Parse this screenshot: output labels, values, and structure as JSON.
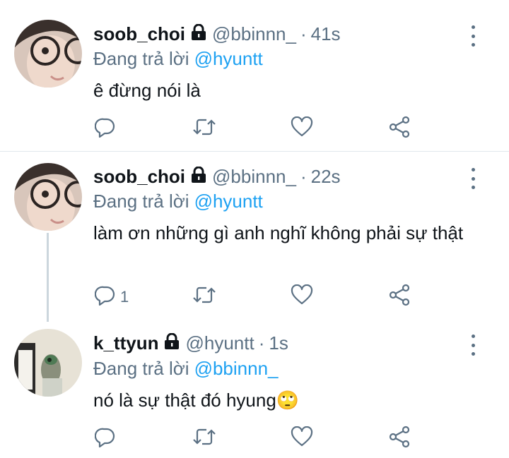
{
  "tweets": [
    {
      "name": "soob_choi",
      "handle": "@bbinnn_",
      "separator": "·",
      "time": "41s",
      "reply_prefix": "Đang trả lời",
      "reply_to": "@hyuntt",
      "text": "ê đừng nói là",
      "reply_count": ""
    },
    {
      "name": "soob_choi",
      "handle": "@bbinnn_",
      "separator": "·",
      "time": "22s",
      "reply_prefix": "Đang trả lời",
      "reply_to": "@hyuntt",
      "text": "làm ơn những gì anh nghĩ không phải sự thật",
      "reply_count": "1"
    },
    {
      "name": "k_ttyun",
      "handle": "@hyuntt",
      "separator": "·",
      "time": "1s",
      "reply_prefix": "Đang trả lời",
      "reply_to": "@bbinnn_",
      "text": "nó là sự thật đó hyung🙄",
      "reply_count": ""
    }
  ],
  "icons": {
    "reply": "comment-icon",
    "retweet": "retweet-icon",
    "like": "heart-icon",
    "share": "share-icon",
    "lock": "lock-icon",
    "more": "more-vertical-icon"
  },
  "colors": {
    "text": "#0f1419",
    "secondary": "#5b7083",
    "mention": "#1da1f2",
    "divider": "#e1e8ed"
  }
}
